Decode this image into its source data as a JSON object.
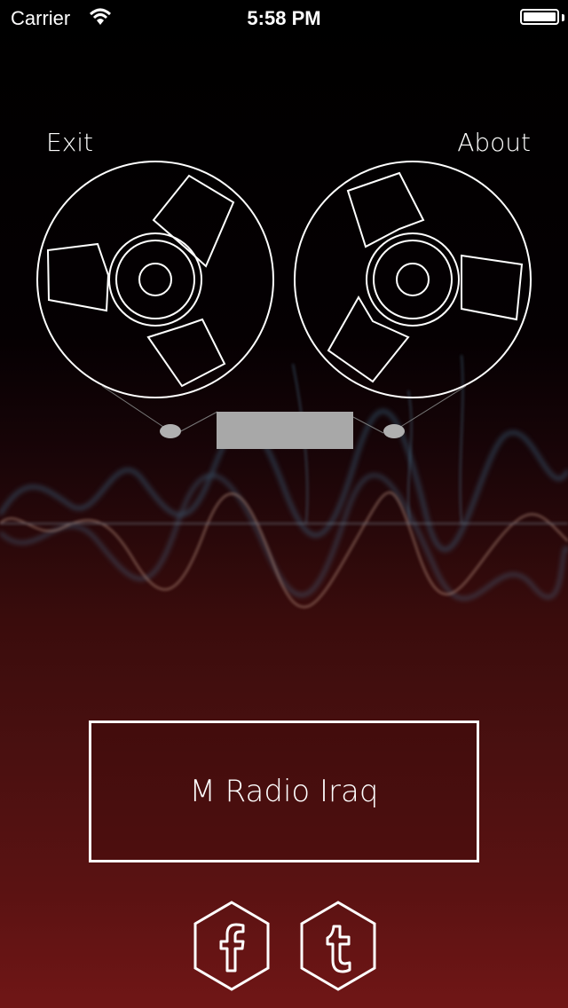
{
  "status_bar": {
    "carrier": "Carrier",
    "time": "5:58 PM",
    "battery_level": 1.0
  },
  "nav": {
    "exit_label": "Exit",
    "about_label": "About"
  },
  "station": {
    "name": "M Radio Iraq"
  },
  "social": {
    "facebook_icon": "facebook-icon",
    "tumblr_icon": "tumblr-icon"
  },
  "colors": {
    "background_top": "#000000",
    "background_bottom": "#701616",
    "line": "#ffffff",
    "tape_window": "#a8a8a8"
  }
}
